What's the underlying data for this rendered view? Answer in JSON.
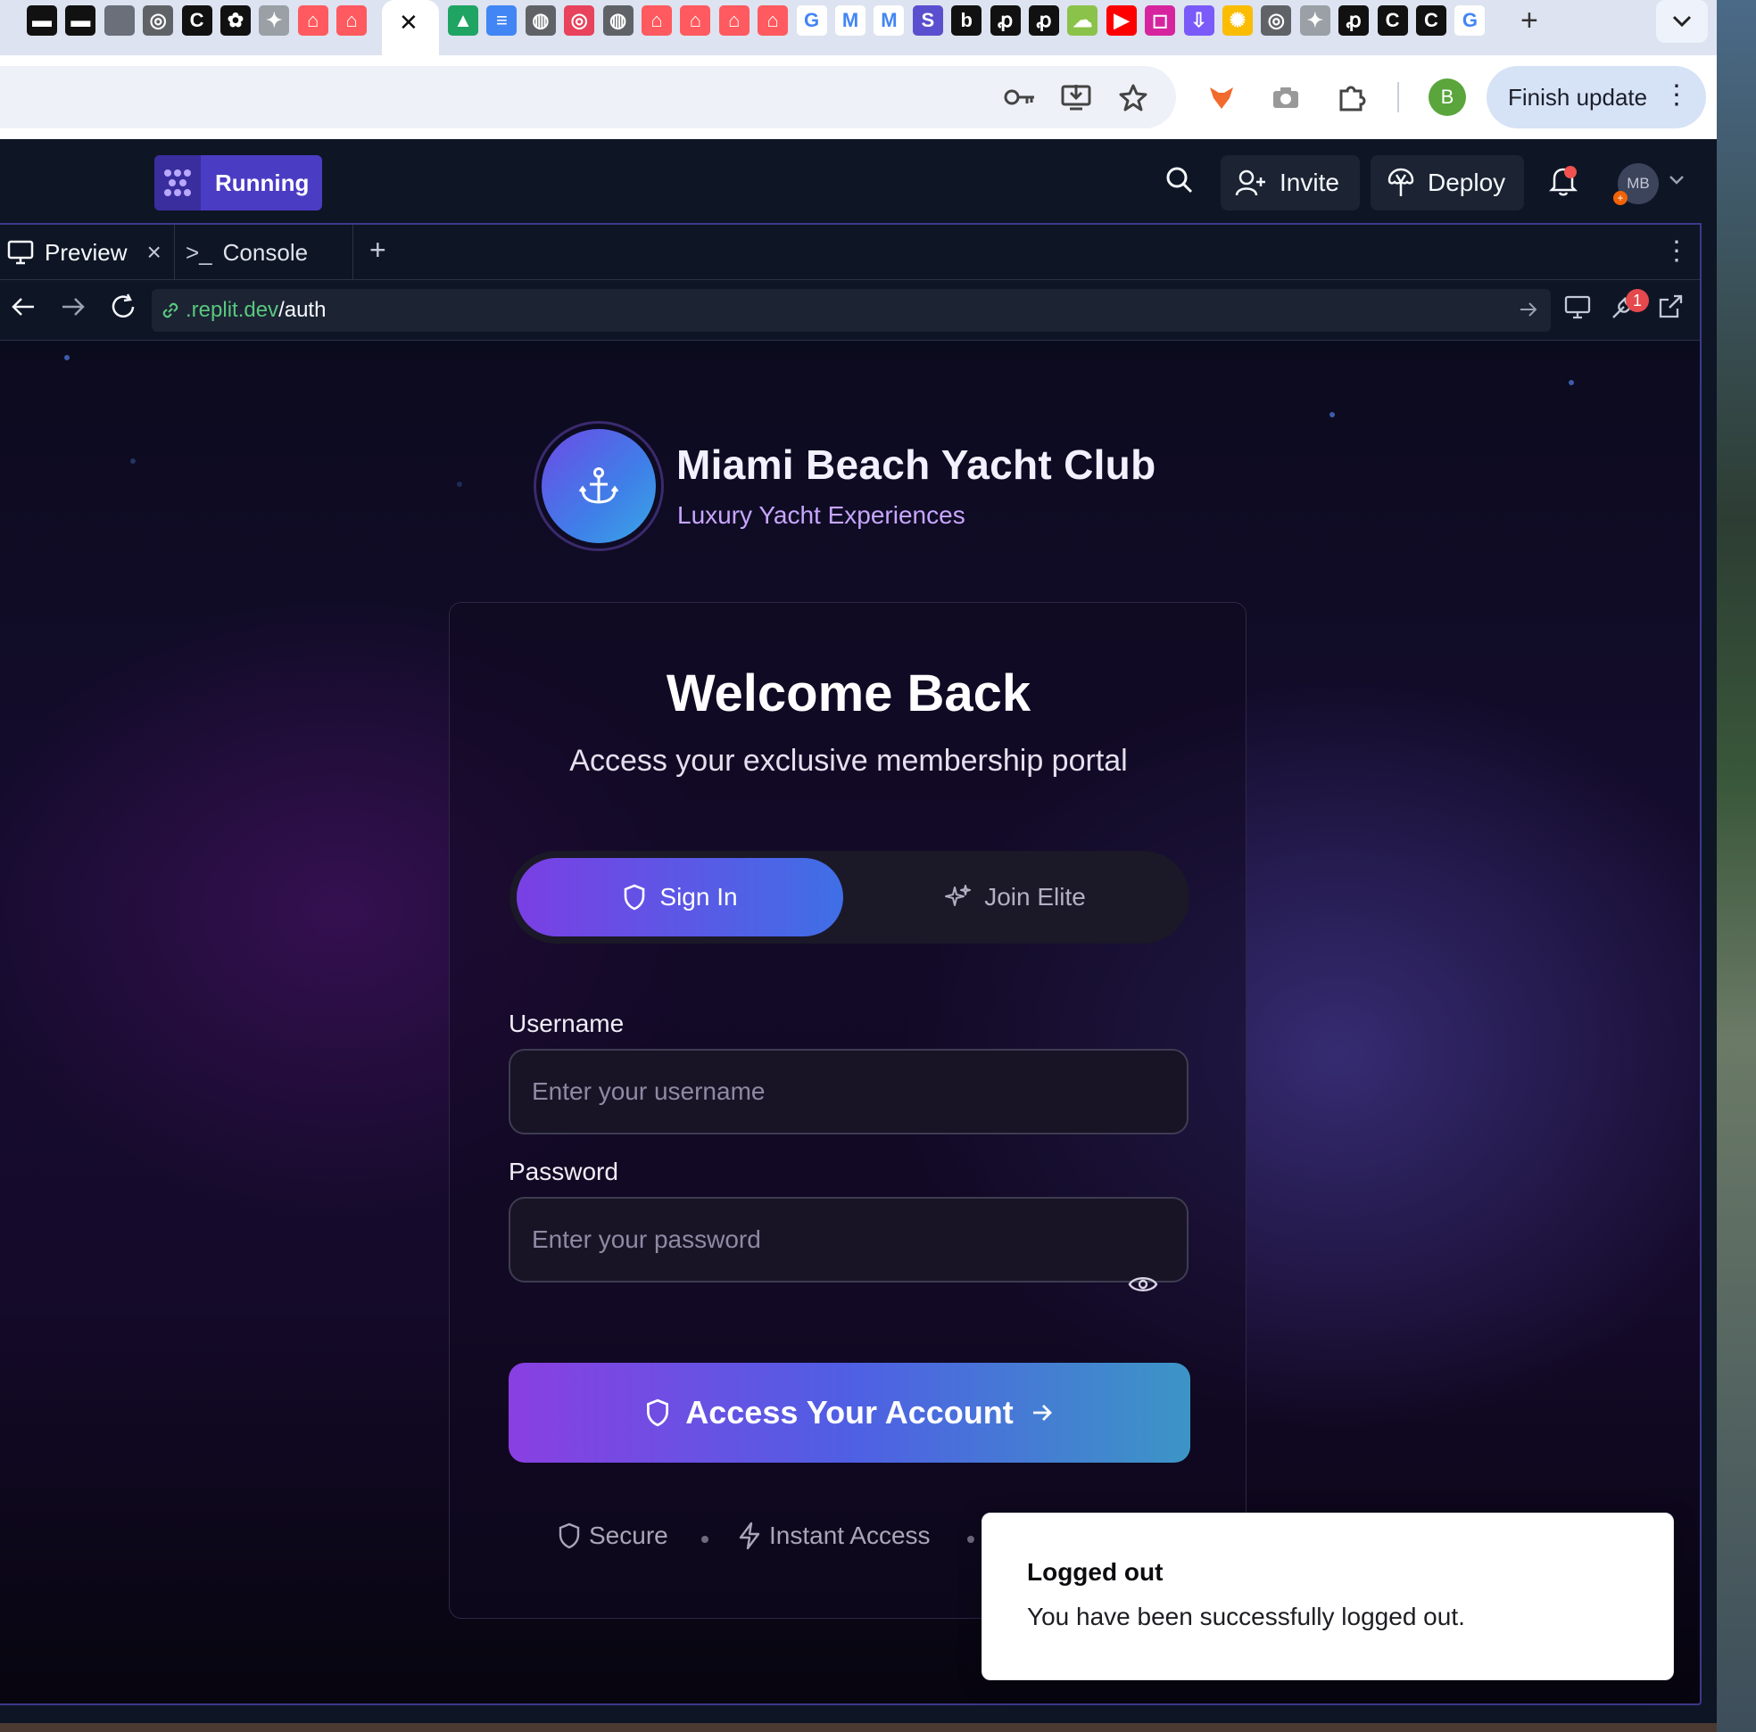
{
  "browser": {
    "active_tab_close": "✕",
    "new_tab": "+",
    "favicons": [
      {
        "name": "spacer-icon",
        "glyph": "▬",
        "bg": "#111111"
      },
      {
        "name": "spacer-icon",
        "glyph": "▬",
        "bg": "#111111"
      },
      {
        "name": "rbc-icon",
        "glyph": "",
        "bg": "#6b6f7a"
      },
      {
        "name": "chrome-icon",
        "glyph": "◎",
        "bg": "#5f6368"
      },
      {
        "name": "c-icon",
        "glyph": "C",
        "bg": "#111111"
      },
      {
        "name": "openai-icon",
        "glyph": "✿",
        "bg": "#111111"
      },
      {
        "name": "pinwheel-icon",
        "glyph": "✦",
        "bg": "#9aa0a6"
      },
      {
        "name": "airbnb-icon",
        "glyph": "⌂",
        "bg": "#ff5a5f"
      },
      {
        "name": "airbnb-icon",
        "glyph": "⌂",
        "bg": "#ff5a5f"
      }
    ],
    "favicons_right": [
      {
        "name": "drive-icon",
        "glyph": "▲",
        "bg": "#1fa463"
      },
      {
        "name": "docs-icon",
        "glyph": "≡",
        "bg": "#4285f4"
      },
      {
        "name": "globe-icon",
        "glyph": "◍",
        "bg": "#5f6368"
      },
      {
        "name": "target-icon",
        "glyph": "◎",
        "bg": "#e8425c"
      },
      {
        "name": "globe-icon",
        "glyph": "◍",
        "bg": "#5f6368"
      },
      {
        "name": "airbnb-icon",
        "glyph": "⌂",
        "bg": "#ff5a5f"
      },
      {
        "name": "airbnb-icon",
        "glyph": "⌂",
        "bg": "#ff5a5f"
      },
      {
        "name": "airbnb-icon",
        "glyph": "⌂",
        "bg": "#ff5a5f"
      },
      {
        "name": "airbnb-icon",
        "glyph": "⌂",
        "bg": "#ff5a5f"
      },
      {
        "name": "google-icon",
        "glyph": "G",
        "bg": "#ffffff"
      },
      {
        "name": "gmail-icon",
        "glyph": "M",
        "bg": "#ffffff"
      },
      {
        "name": "gmail-icon",
        "glyph": "M",
        "bg": "#ffffff"
      },
      {
        "name": "s-icon",
        "glyph": "S",
        "bg": "#5a4fcf"
      },
      {
        "name": "b-icon",
        "glyph": "b",
        "bg": "#111111"
      },
      {
        "name": "p-icon",
        "glyph": "ꝓ",
        "bg": "#111111"
      },
      {
        "name": "p-icon",
        "glyph": "ꝓ",
        "bg": "#111111"
      },
      {
        "name": "cloud-icon",
        "glyph": "☁",
        "bg": "#8bc34a"
      },
      {
        "name": "youtube-icon",
        "glyph": "▶",
        "bg": "#ff0000"
      },
      {
        "name": "instagram-icon",
        "glyph": "◻",
        "bg": "#d6249f"
      },
      {
        "name": "download-icon",
        "glyph": "⇩",
        "bg": "#7a5af8"
      },
      {
        "name": "photos-icon",
        "glyph": "✺",
        "bg": "#fbbc04"
      },
      {
        "name": "chrome-icon",
        "glyph": "◎",
        "bg": "#5f6368"
      },
      {
        "name": "pinwheel-icon",
        "glyph": "✦",
        "bg": "#9aa0a6"
      },
      {
        "name": "p-icon",
        "glyph": "ꝓ",
        "bg": "#111111"
      },
      {
        "name": "c-icon",
        "glyph": "C",
        "bg": "#111111"
      },
      {
        "name": "c-icon",
        "glyph": "C",
        "bg": "#111111"
      },
      {
        "name": "google-icon",
        "glyph": "G",
        "bg": "#ffffff"
      }
    ],
    "profile_initial": "B",
    "finish_update": "Finish update",
    "finish_update_more": "⋮"
  },
  "workspace": {
    "run_label": "Running",
    "invite_label": "Invite",
    "deploy_label": "Deploy",
    "avatar_initials": "MB",
    "avatar_badge": "+",
    "tabs": {
      "preview": "Preview",
      "preview_close": "×",
      "console": "Console",
      "console_prompt": ">_",
      "add": "+",
      "more": "⋮"
    },
    "url": {
      "host": ".replit.dev",
      "path": "/auth"
    },
    "devtools_badge": "1"
  },
  "app": {
    "brand_title": "Miami Beach Yacht Club",
    "brand_subtitle": "Luxury Yacht Experiences",
    "heading": "Welcome Back",
    "subheading": "Access your exclusive membership portal",
    "tab_signin": "Sign In",
    "tab_join": "Join Elite",
    "username_label": "Username",
    "username_placeholder": "Enter your username",
    "password_label": "Password",
    "password_placeholder": "Enter your password",
    "submit_label": "Access Your Account",
    "features": [
      "Secure",
      "Instant Access"
    ]
  },
  "toast": {
    "title": "Logged out",
    "message": "You have been successfully logged out."
  },
  "colors": {
    "accent_purple": "#7a3fe4",
    "accent_blue": "#3f6fe6",
    "replit_run": "#4b3cc4",
    "url_host": "#58c87e"
  }
}
